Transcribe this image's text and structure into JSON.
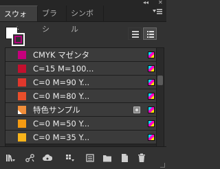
{
  "window": {
    "collapse_glyph": "◂◂",
    "close_glyph": "✕"
  },
  "tabs": [
    {
      "label": "スウォッチ",
      "active": true
    },
    {
      "label": "ブラシ",
      "active": false
    },
    {
      "label": "シンボル",
      "active": false
    }
  ],
  "panel_menu_icon": "panel-menu-icon",
  "fill_stroke": {
    "fill_color": "#ffffff",
    "stroke_color": "#b4007e"
  },
  "view_buttons": [
    {
      "name": "list-view-button",
      "active": false
    },
    {
      "name": "large-list-view-button",
      "active": true
    }
  ],
  "swatches": [
    {
      "name": "CMYK マゼンタ",
      "color": "#c5007d",
      "type": "process",
      "selected": false
    },
    {
      "name": "C=15 M=100...",
      "color": "#c2102e",
      "type": "process",
      "selected": false
    },
    {
      "name": "C=0 M=90 Y...",
      "color": "#e0372c",
      "type": "process",
      "selected": false
    },
    {
      "name": "C=0 M=80 Y...",
      "color": "#e94f2b",
      "type": "process",
      "selected": false
    },
    {
      "name": "特色サンプル",
      "color": "#f18e3a",
      "type": "spot",
      "selected": false
    },
    {
      "name": "C=0 M=50 Y...",
      "color": "#f59b12",
      "type": "process",
      "selected": false
    },
    {
      "name": "C=0 M=35 Y...",
      "color": "#f8b41b",
      "type": "process",
      "selected": false
    }
  ],
  "bottom_toolbar": [
    "swatch-library-menu-icon",
    "place-swatches-icon",
    "cc-libraries-icon",
    "swatch-kinds-menu-icon",
    "swatch-options-icon",
    "new-color-group-icon",
    "new-swatch-icon",
    "delete-swatch-icon"
  ]
}
